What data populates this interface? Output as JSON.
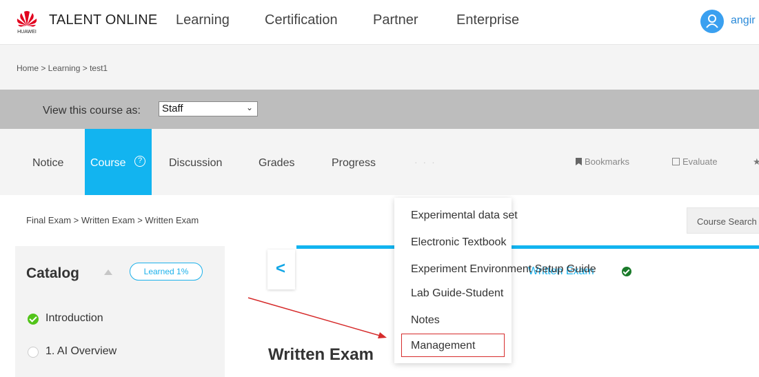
{
  "header": {
    "brand_name": "TALENT ONLINE",
    "logo_text": "HUAWEI",
    "nav": [
      "Learning",
      "Certification",
      "Partner",
      "Enterprise"
    ],
    "username": "angir"
  },
  "breadcrumb_top": "Home  >  Learning  >  test1",
  "view_bar": {
    "label": "View this course as:",
    "selected": "Staff"
  },
  "tabs": {
    "items": [
      "Notice",
      "Course",
      "Discussion",
      "Grades",
      "Progress"
    ],
    "active": "Course",
    "more": "· · ·",
    "tools": [
      "Bookmarks",
      "Evaluate"
    ]
  },
  "path": "Final Exam  >  Written Exam  >  Written Exam",
  "course_search": "Course Search",
  "catalog": {
    "title": "Catalog",
    "progress_badge": "Learned 1%",
    "items": [
      "Introduction",
      "1. AI Overview"
    ]
  },
  "unit": {
    "link": "Written Exam",
    "title": "Written Exam"
  },
  "more_menu": {
    "items": [
      "Experimental data set",
      "Electronic Textbook",
      "Experiment Environment Setup Guide",
      "Lab Guide-Student",
      "Notes",
      "Management"
    ],
    "highlighted": "Management"
  },
  "colors": {
    "accent": "#12b4f0",
    "annotation": "#d62b2b",
    "success": "#52c41a"
  }
}
